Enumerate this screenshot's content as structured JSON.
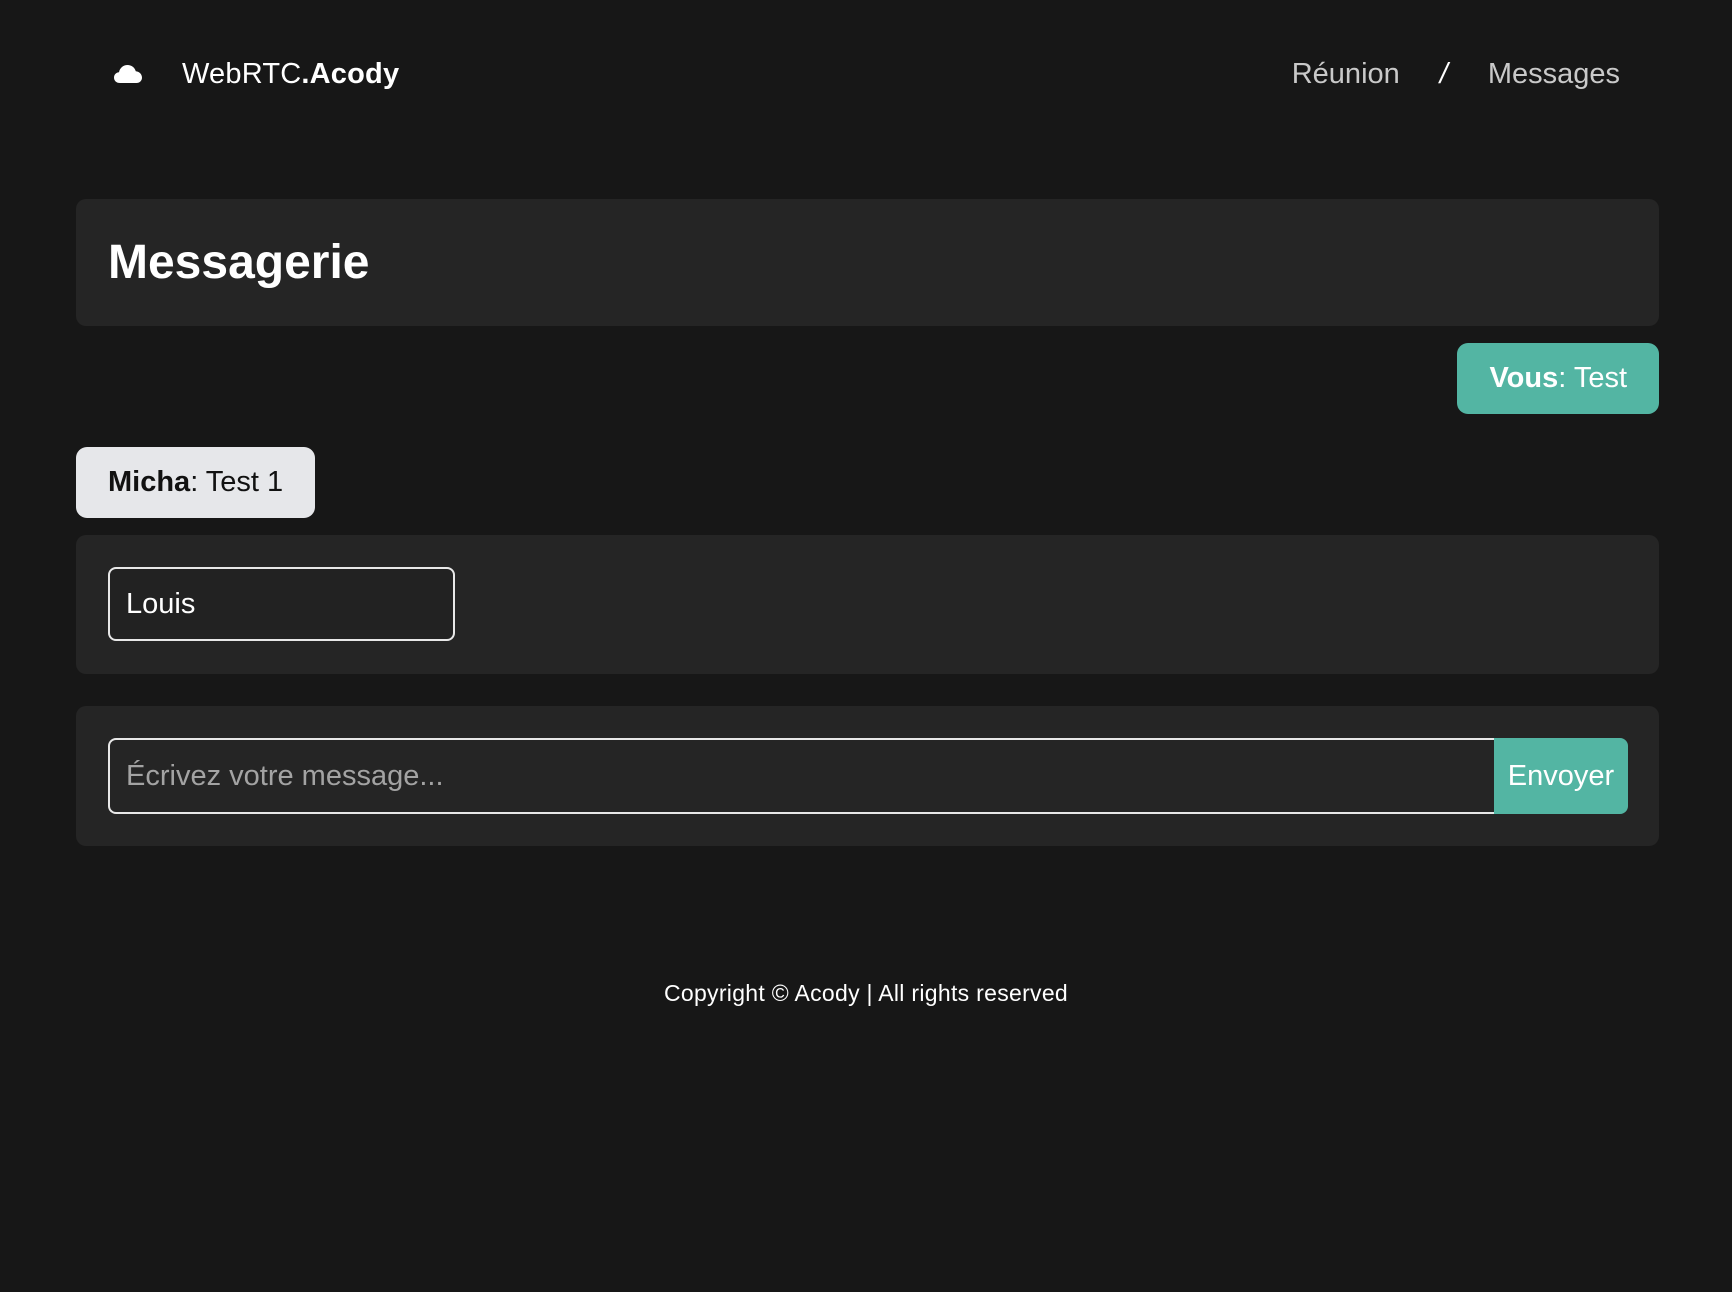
{
  "header": {
    "brand": {
      "prefix": "WebRTC",
      "suffix": ".Acody",
      "icon": "cloud-icon"
    },
    "nav": {
      "items": [
        {
          "label": "Réunion"
        },
        {
          "label": "Messages"
        }
      ],
      "separator": "/"
    }
  },
  "main": {
    "title": "Messagerie",
    "messages": [
      {
        "sender": "Vous",
        "separator": ":",
        "text": " Test",
        "direction": "outgoing",
        "color": "#53b5a3"
      },
      {
        "sender": "Micha",
        "separator": ":",
        "text": " Test 1",
        "direction": "incoming",
        "color": "#e6e7ea"
      }
    ],
    "name_field": {
      "value": "Louis"
    },
    "compose": {
      "placeholder": "Écrivez votre message...",
      "value": "",
      "send_label": "Envoyer"
    }
  },
  "footer": {
    "text": "Copyright © Acody | All rights reserved"
  },
  "colors": {
    "background": "#171717",
    "card": "#252525",
    "accent": "#53b5a3"
  }
}
